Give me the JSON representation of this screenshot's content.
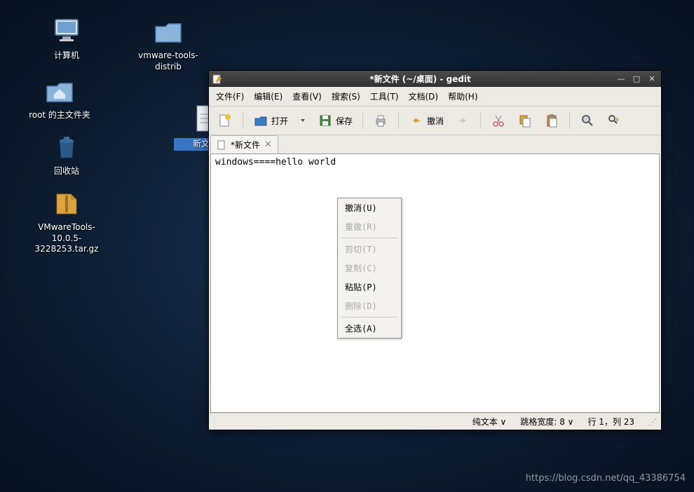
{
  "desktop": {
    "icons": [
      {
        "name": "computer",
        "label": "计算机"
      },
      {
        "name": "home",
        "label": "root 的主文件夹"
      },
      {
        "name": "trash",
        "label": "回收站"
      },
      {
        "name": "archive",
        "label": "VMwareTools-10.0.5-3228253.tar.gz"
      },
      {
        "name": "folder",
        "label": "vmware-tools-distrib"
      },
      {
        "name": "newfile",
        "label": "新文件"
      }
    ]
  },
  "window": {
    "title": "*新文件 (~/桌面) - gedit",
    "menus": [
      "文件(F)",
      "编辑(E)",
      "查看(V)",
      "搜索(S)",
      "工具(T)",
      "文档(D)",
      "帮助(H)"
    ],
    "toolbar": {
      "open": "打开",
      "save": "保存",
      "undo": "撤消"
    },
    "tab": "*新文件",
    "editor_text": "windows====hello world",
    "statusbar": {
      "mode": "纯文本",
      "tab_label": "跳格宽度:",
      "tab_width": "8",
      "pos": "行 1，列 23"
    }
  },
  "context_menu": {
    "undo": "撤消(U)",
    "redo": "重做(R)",
    "cut": "剪切(T)",
    "copy": "复制(C)",
    "paste": "粘贴(P)",
    "delete": "删除(D)",
    "select_all": "全选(A)"
  },
  "watermark": "https://blog.csdn.net/qq_43386754"
}
